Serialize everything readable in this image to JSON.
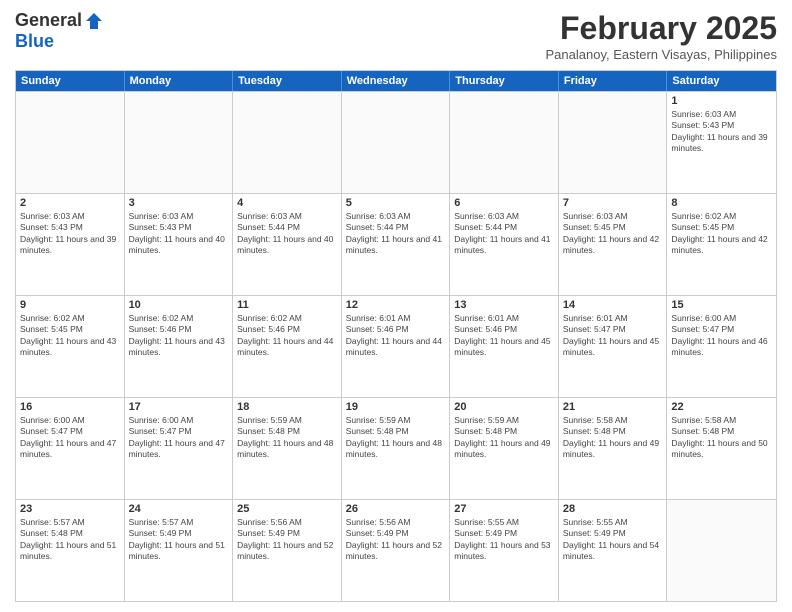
{
  "header": {
    "logo_general": "General",
    "logo_blue": "Blue",
    "month_year": "February 2025",
    "location": "Panalanoy, Eastern Visayas, Philippines"
  },
  "calendar": {
    "days_of_week": [
      "Sunday",
      "Monday",
      "Tuesday",
      "Wednesday",
      "Thursday",
      "Friday",
      "Saturday"
    ],
    "rows": [
      [
        {
          "day": "",
          "info": ""
        },
        {
          "day": "",
          "info": ""
        },
        {
          "day": "",
          "info": ""
        },
        {
          "day": "",
          "info": ""
        },
        {
          "day": "",
          "info": ""
        },
        {
          "day": "",
          "info": ""
        },
        {
          "day": "1",
          "info": "Sunrise: 6:03 AM\nSunset: 5:43 PM\nDaylight: 11 hours and 39 minutes."
        }
      ],
      [
        {
          "day": "2",
          "info": "Sunrise: 6:03 AM\nSunset: 5:43 PM\nDaylight: 11 hours and 39 minutes."
        },
        {
          "day": "3",
          "info": "Sunrise: 6:03 AM\nSunset: 5:43 PM\nDaylight: 11 hours and 40 minutes."
        },
        {
          "day": "4",
          "info": "Sunrise: 6:03 AM\nSunset: 5:44 PM\nDaylight: 11 hours and 40 minutes."
        },
        {
          "day": "5",
          "info": "Sunrise: 6:03 AM\nSunset: 5:44 PM\nDaylight: 11 hours and 41 minutes."
        },
        {
          "day": "6",
          "info": "Sunrise: 6:03 AM\nSunset: 5:44 PM\nDaylight: 11 hours and 41 minutes."
        },
        {
          "day": "7",
          "info": "Sunrise: 6:03 AM\nSunset: 5:45 PM\nDaylight: 11 hours and 42 minutes."
        },
        {
          "day": "8",
          "info": "Sunrise: 6:02 AM\nSunset: 5:45 PM\nDaylight: 11 hours and 42 minutes."
        }
      ],
      [
        {
          "day": "9",
          "info": "Sunrise: 6:02 AM\nSunset: 5:45 PM\nDaylight: 11 hours and 43 minutes."
        },
        {
          "day": "10",
          "info": "Sunrise: 6:02 AM\nSunset: 5:46 PM\nDaylight: 11 hours and 43 minutes."
        },
        {
          "day": "11",
          "info": "Sunrise: 6:02 AM\nSunset: 5:46 PM\nDaylight: 11 hours and 44 minutes."
        },
        {
          "day": "12",
          "info": "Sunrise: 6:01 AM\nSunset: 5:46 PM\nDaylight: 11 hours and 44 minutes."
        },
        {
          "day": "13",
          "info": "Sunrise: 6:01 AM\nSunset: 5:46 PM\nDaylight: 11 hours and 45 minutes."
        },
        {
          "day": "14",
          "info": "Sunrise: 6:01 AM\nSunset: 5:47 PM\nDaylight: 11 hours and 45 minutes."
        },
        {
          "day": "15",
          "info": "Sunrise: 6:00 AM\nSunset: 5:47 PM\nDaylight: 11 hours and 46 minutes."
        }
      ],
      [
        {
          "day": "16",
          "info": "Sunrise: 6:00 AM\nSunset: 5:47 PM\nDaylight: 11 hours and 47 minutes."
        },
        {
          "day": "17",
          "info": "Sunrise: 6:00 AM\nSunset: 5:47 PM\nDaylight: 11 hours and 47 minutes."
        },
        {
          "day": "18",
          "info": "Sunrise: 5:59 AM\nSunset: 5:48 PM\nDaylight: 11 hours and 48 minutes."
        },
        {
          "day": "19",
          "info": "Sunrise: 5:59 AM\nSunset: 5:48 PM\nDaylight: 11 hours and 48 minutes."
        },
        {
          "day": "20",
          "info": "Sunrise: 5:59 AM\nSunset: 5:48 PM\nDaylight: 11 hours and 49 minutes."
        },
        {
          "day": "21",
          "info": "Sunrise: 5:58 AM\nSunset: 5:48 PM\nDaylight: 11 hours and 49 minutes."
        },
        {
          "day": "22",
          "info": "Sunrise: 5:58 AM\nSunset: 5:48 PM\nDaylight: 11 hours and 50 minutes."
        }
      ],
      [
        {
          "day": "23",
          "info": "Sunrise: 5:57 AM\nSunset: 5:48 PM\nDaylight: 11 hours and 51 minutes."
        },
        {
          "day": "24",
          "info": "Sunrise: 5:57 AM\nSunset: 5:49 PM\nDaylight: 11 hours and 51 minutes."
        },
        {
          "day": "25",
          "info": "Sunrise: 5:56 AM\nSunset: 5:49 PM\nDaylight: 11 hours and 52 minutes."
        },
        {
          "day": "26",
          "info": "Sunrise: 5:56 AM\nSunset: 5:49 PM\nDaylight: 11 hours and 52 minutes."
        },
        {
          "day": "27",
          "info": "Sunrise: 5:55 AM\nSunset: 5:49 PM\nDaylight: 11 hours and 53 minutes."
        },
        {
          "day": "28",
          "info": "Sunrise: 5:55 AM\nSunset: 5:49 PM\nDaylight: 11 hours and 54 minutes."
        },
        {
          "day": "",
          "info": ""
        }
      ]
    ]
  }
}
